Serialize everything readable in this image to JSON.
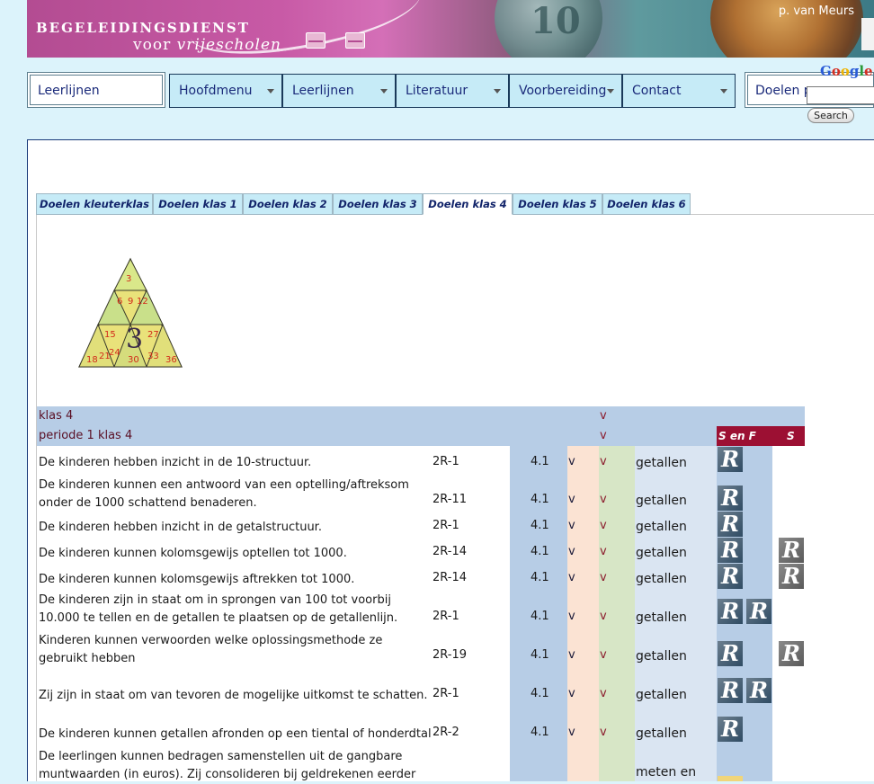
{
  "banner": {
    "brand_line1": "BEGELEIDINGSDIENST",
    "brand_line2_prefix": "voor ",
    "brand_line2_italic": "vrijescholen",
    "coin_number": "10",
    "author": "p. van Meurs"
  },
  "nav": {
    "left_label": "Leerlijnen",
    "menus": [
      {
        "label": "Hoofdmenu"
      },
      {
        "label": "Leerlijnen"
      },
      {
        "label": "Literatuur"
      },
      {
        "label": "Voorbereiding"
      },
      {
        "label": "Contact"
      }
    ],
    "right_label": "Doelen p",
    "search": {
      "brand": "Google",
      "button": "Search",
      "value": ""
    }
  },
  "tabs": [
    {
      "label": "Doelen kleuterklas",
      "active": false
    },
    {
      "label": "Doelen klas 1",
      "active": false
    },
    {
      "label": "Doelen klas 2",
      "active": false
    },
    {
      "label": "Doelen klas 3",
      "active": false
    },
    {
      "label": "Doelen klas 4",
      "active": true
    },
    {
      "label": "Doelen klas 5",
      "active": false
    },
    {
      "label": "Doelen klas 6",
      "active": false
    }
  ],
  "pyramid": {
    "center": "3",
    "numbers": [
      "3",
      "6",
      "9",
      "12",
      "15",
      "18",
      "21",
      "24",
      "27",
      "30",
      "33",
      "36"
    ]
  },
  "table": {
    "section_title": "klas 4",
    "period_title": "periode 1 klas 4",
    "section_v": "v",
    "period_v": "v",
    "sf_header": "S en F",
    "s_header": "S",
    "rows": [
      {
        "text": "De kinderen hebben inzicht in de 10-structuur.",
        "code": "2R-1",
        "num": "4.1",
        "v1": "v",
        "v2": "v",
        "domain": "getallen",
        "r": [
          "R"
        ]
      },
      {
        "text": "De kinderen kunnen een antwoord van een optelling/aftreksom onder de 1000    schattend benaderen.",
        "code": "2R-11",
        "num": "4.1",
        "v1": "v",
        "v2": "v",
        "domain": "getallen",
        "r": [
          "R"
        ]
      },
      {
        "text": "De kinderen hebben inzicht in de getalstructuur.",
        "code": "2R-1",
        "num": "4.1",
        "v1": "v",
        "v2": "v",
        "domain": "getallen",
        "r": [
          "R"
        ]
      },
      {
        "text": "De kinderen kunnen kolomsgewijs optellen tot 1000.",
        "code": "2R-14",
        "num": "4.1",
        "v1": "v",
        "v2": "v",
        "domain": "getallen",
        "r": [
          "R"
        ],
        "s": "R"
      },
      {
        "text": "De kinderen kunnen kolomsgewijs aftrekken tot 1000.",
        "code": "2R-14",
        "num": "4.1",
        "v1": "v",
        "v2": "v",
        "domain": "getallen",
        "r": [
          "R"
        ],
        "s": "R"
      },
      {
        "text": "De kinderen zijn in staat om in sprongen van 100 tot voorbij 10.000 te tellen en de getallen te plaatsen op de getallenlijn.",
        "code": "2R-1",
        "num": "4.1",
        "v1": "v",
        "v2": "v",
        "domain": "getallen",
        "r": [
          "R",
          "R"
        ]
      },
      {
        "text": "Kinderen kunnen verwoorden welke oplossingsmethode ze gebruikt hebben",
        "code": "2R-19",
        "num": "4.1",
        "v1": "v",
        "v2": "v",
        "domain": "getallen",
        "r": [
          "R"
        ],
        "s": "R"
      },
      {
        "text": "Zij zijn in staat om van tevoren de mogelijke uitkomst te schatten.",
        "code": "2R-1",
        "num": "4.1",
        "v1": "v",
        "v2": "v",
        "domain": "getallen",
        "r": [
          "R",
          "R"
        ]
      },
      {
        "text": "De kinderen kunnen getallen afronden op een tiental of honderdtal",
        "code": "2R-2",
        "num": "4.1",
        "v1": "v",
        "v2": "v",
        "domain": "getallen",
        "r": [
          "R"
        ]
      },
      {
        "text": "De leerlingen kunnen bedragen samenstellen uit de gangbare muntwaarden (in euros). Zij consolideren bij geldrekenen eerder",
        "code": "",
        "num": "",
        "v1": "",
        "v2": "",
        "domain": "meten en",
        "r": []
      }
    ]
  }
}
